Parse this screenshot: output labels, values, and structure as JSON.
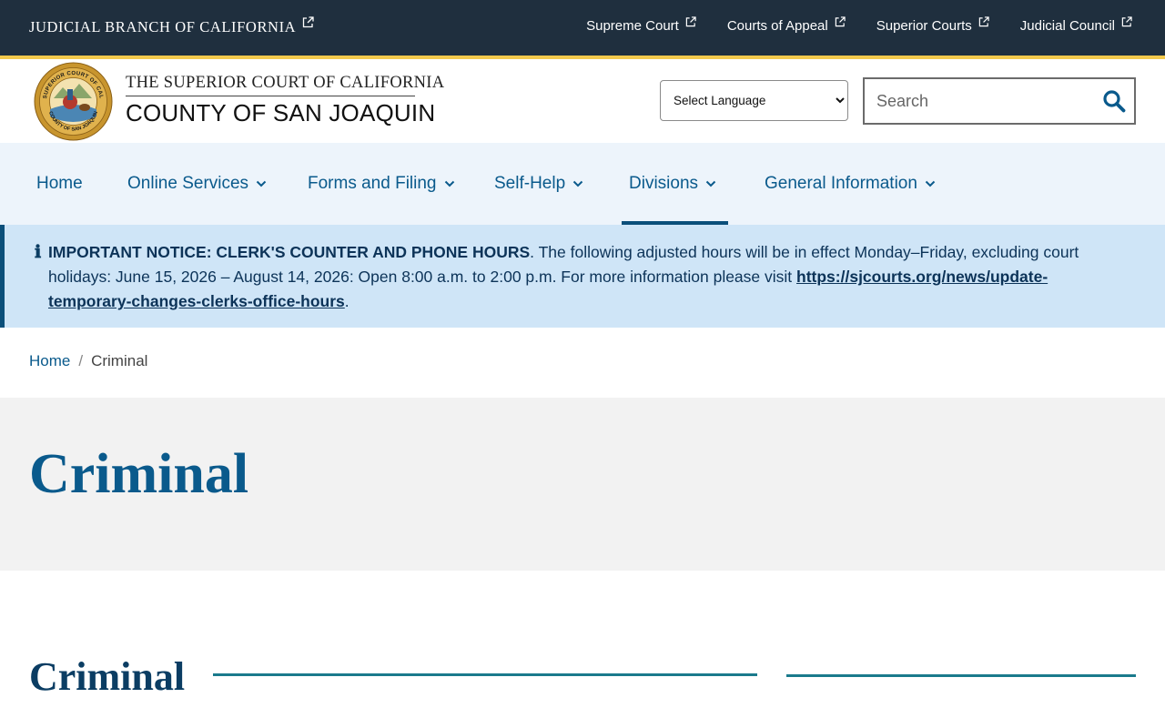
{
  "utility": {
    "branch_label": "JUDICIAL BRANCH OF CALIFORNIA",
    "links": [
      {
        "label": "Supreme Court"
      },
      {
        "label": "Courts of Appeal"
      },
      {
        "label": "Superior Courts"
      },
      {
        "label": "Judicial Council"
      }
    ]
  },
  "header": {
    "title_line1": "THE SUPERIOR COURT OF CALIFORNIA",
    "title_line2": "COUNTY OF SAN JOAQUIN",
    "seal_text": "SUPERIOR COURT OF CALIFORNIA · COUNTY OF SAN JOAQUIN",
    "language_select": "Select Language",
    "search_placeholder": "Search"
  },
  "nav": {
    "items": [
      {
        "label": "Home"
      },
      {
        "label": "Online Services"
      },
      {
        "label": "Forms and Filing"
      },
      {
        "label": "Self-Help"
      },
      {
        "label": "Divisions"
      },
      {
        "label": "General Information"
      }
    ],
    "active": "Divisions"
  },
  "notice": {
    "heading": "IMPORTANT NOTICE: CLERK'S COUNTER AND PHONE HOURS",
    "body": ". The following adjusted hours will be in effect Monday–Friday, excluding court holidays: June 15, 2026 – August 14, 2026: Open 8:00 a.m. to 2:00 p.m. For more information please visit ",
    "link_text": "https://sjcourts.org/news/update-temporary-changes-clerks-office-hours",
    "trailing": "."
  },
  "breadcrumb": {
    "home": "Home",
    "separator": "/",
    "current": "Criminal"
  },
  "page": {
    "title": "Criminal",
    "section_heading": "Criminal"
  },
  "colors": {
    "utility_bg": "#1f2f3e",
    "accent_gold": "#f2c94c",
    "nav_bg": "#edf4fb",
    "link_blue": "#0a5a8c",
    "notice_bg": "#cfe5f7",
    "teal_rule": "#1a7a8c"
  }
}
